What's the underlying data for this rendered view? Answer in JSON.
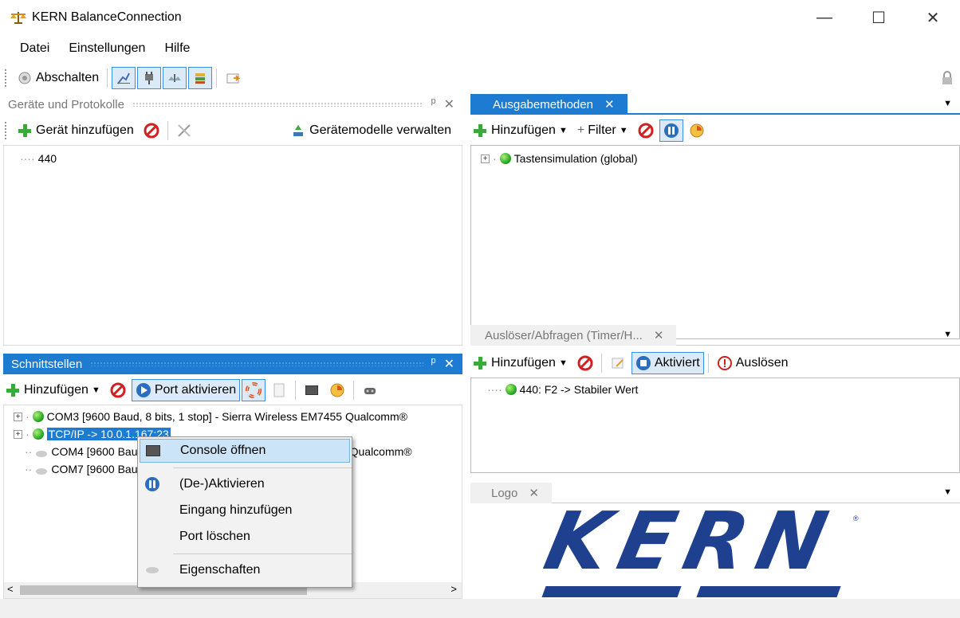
{
  "window": {
    "title": "KERN BalanceConnection"
  },
  "menu": [
    "Datei",
    "Einstellungen",
    "Hilfe"
  ],
  "toolbar": {
    "shutdown_label": "Abschalten"
  },
  "devices_panel": {
    "title": "Geräte und Protokolle",
    "add_device_label": "Gerät hinzufügen",
    "manage_models_label": "Gerätemodelle verwalten",
    "items": [
      "440"
    ]
  },
  "interfaces_panel": {
    "title": "Schnittstellen",
    "add_label": "Hinzufügen",
    "activate_port_label": "Port aktivieren",
    "items": [
      {
        "text": "COM3 [9600 Baud, 8 bits, 1 stop] - Sierra Wireless EM7455 Qualcomm®",
        "status": "active",
        "expandable": true
      },
      {
        "text": "TCP/IP -> 10.0.1.167:23",
        "status": "active",
        "expandable": true,
        "selected": true
      },
      {
        "text": "COM4 [9600 Baud, 8 bits, 1 stop] - Sierra Wireless EM7455 Qualcomm®",
        "status": "inactive",
        "expandable": false
      },
      {
        "text": "COM7 [9600 Baud, 8 bits, 1 stop]",
        "status": "inactive",
        "expandable": false
      }
    ]
  },
  "output_panel": {
    "title": "Ausgabemethoden",
    "add_label": "Hinzufügen",
    "filter_label": "Filter",
    "items": [
      "Tastensimulation (global)"
    ]
  },
  "triggers_panel": {
    "title": "Auslöser/Abfragen (Timer/H...",
    "add_label": "Hinzufügen",
    "activated_label": "Aktiviert",
    "trigger_label": "Auslösen",
    "items": [
      "440: F2 -> Stabiler Wert"
    ]
  },
  "logo_panel": {
    "title": "Logo",
    "logo_text": "KERN"
  },
  "context_menu": {
    "items": [
      "Console öffnen",
      "(De-)Aktivieren",
      "Eingang hinzufügen",
      "Port löschen",
      "Eigenschaften"
    ]
  },
  "colors": {
    "accent": "#1d7bd1",
    "logo_blue": "#1f3f8f"
  }
}
